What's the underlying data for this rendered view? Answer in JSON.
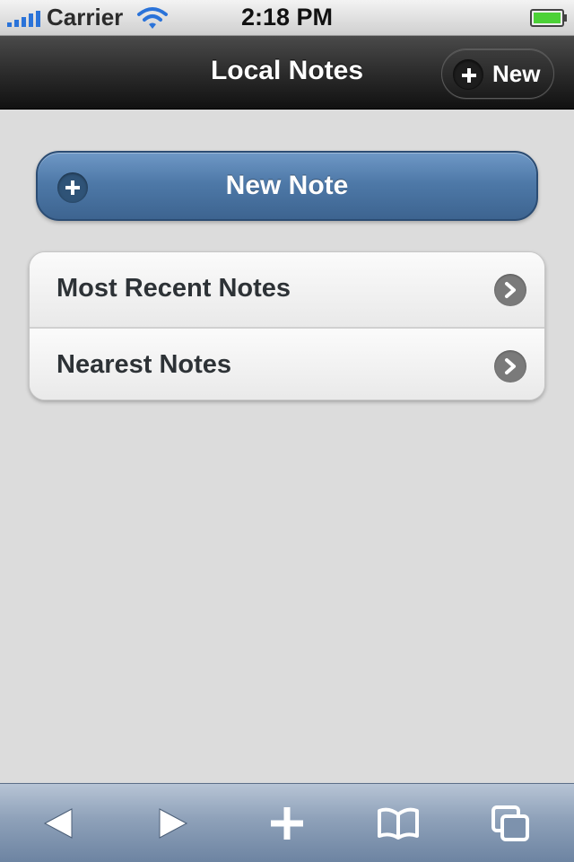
{
  "status_bar": {
    "carrier": "Carrier",
    "time": "2:18 PM",
    "signal_icon": "signal-bars-icon",
    "wifi_icon": "wifi-icon",
    "battery_icon": "battery-full-icon",
    "battery_color": "#4cd137"
  },
  "header": {
    "title": "Local Notes",
    "new_button_label": "New",
    "new_button_icon": "plus-icon"
  },
  "main": {
    "new_note_label": "New Note",
    "new_note_icon": "plus-icon",
    "accent_color": "#4e79a8",
    "list_items": [
      {
        "label": "Most Recent Notes",
        "icon": "chevron-right-icon"
      },
      {
        "label": "Nearest Notes",
        "icon": "chevron-right-icon"
      }
    ]
  },
  "toolbar": {
    "buttons": [
      {
        "name": "back",
        "icon": "back-arrow-icon"
      },
      {
        "name": "forward",
        "icon": "forward-arrow-icon"
      },
      {
        "name": "add",
        "icon": "plus-icon"
      },
      {
        "name": "bookmarks",
        "icon": "bookmarks-icon"
      },
      {
        "name": "pages",
        "icon": "pages-icon"
      }
    ]
  }
}
